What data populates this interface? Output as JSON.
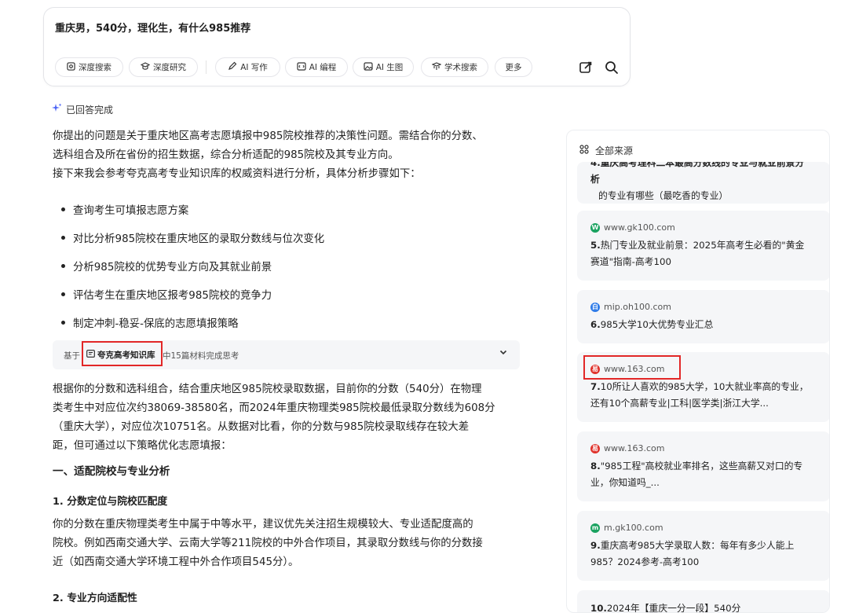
{
  "search": {
    "query": "重庆男，540分，理化生，有什么985推荐",
    "tools": [
      {
        "label": "深度搜索",
        "icon": "deep-search-icon"
      },
      {
        "label": "深度研究",
        "icon": "deep-research-icon"
      },
      {
        "label": "AI 写作",
        "icon": "pen-icon"
      },
      {
        "label": "AI 编程",
        "icon": "code-icon"
      },
      {
        "label": "AI 生图",
        "icon": "image-icon"
      },
      {
        "label": "学术搜索",
        "icon": "academic-icon"
      },
      {
        "label": "更多",
        "icon": ""
      }
    ]
  },
  "answer": {
    "status": "已回答完成",
    "intro": [
      "你提出的问题是关于重庆地区高考志愿填报中985院校推荐的决策性问题。需结合你的分数、",
      "选科组合及所在省份的招生数据，综合分析适配的985院校及其专业方向。",
      "接下来我会参考夸克高考专业知识库的权威资料进行分析，具体分析步骤如下："
    ],
    "steps": [
      "查询考生可填报志愿方案",
      "对比分析985院校在重庆地区的录取分数线与位次变化",
      "分析985院校的优势专业方向及其就业前景",
      "评估考生在重庆地区报考985院校的竞争力",
      "制定冲刺-稳妥-保底的志愿填报策略"
    ],
    "reference": {
      "prefix": "基于",
      "kb_name": "夸克高考知识库",
      "suffix": "中15篇材料完成思考"
    },
    "body1": [
      "根据你的分数和选科组合，结合重庆地区985院校录取数据，目前你的分数（540分）在物理",
      "类考生中对应位次约38069-38580名，而2024年重庆物理类985院校最低录取分数线为608分",
      "（重庆大学），对应位次10751名。从数据对比看，你的分数与985院校录取线存在较大差",
      "距，但可通过以下策略优化志愿填报："
    ],
    "heading1": "一、适配院校与专业分析",
    "heading1_1": "1. 分数定位与院校匹配度",
    "body2": [
      "你的分数在重庆物理类考生中属于中等水平，建议优先关注招生规模较大、专业适配度高的",
      "院校。例如西南交通大学、云南大学等211院校的中外合作项目，其录取分数线与你的分数接",
      "近（如西南交通大学环境工程中外合作项目545分）。"
    ],
    "heading1_2": "2. 专业方向适配性"
  },
  "sources": {
    "header": "全部来源",
    "items": [
      {
        "domain": "",
        "num": "",
        "title": "的专业有哪些（最吃香的专业）",
        "partial_top": "4.重庆高考理科二本最高分数线的专业与就业前景分析"
      },
      {
        "domain": "www.gk100.com",
        "num": "5.",
        "title": "热门专业及就业前景：2025年高考生必看的\"黄金赛道\"指南-高考100",
        "favicon": "gk",
        "color": "#1aa260"
      },
      {
        "domain": "mip.oh100.com",
        "num": "6.",
        "title": "985大学10大优势专业汇总",
        "favicon": "oh",
        "color": "#2f7ce8"
      },
      {
        "domain": "www.163.com",
        "num": "7.",
        "title": "10所让人喜欢的985大学，10大就业率高的专业，还有10个高薪专业|工科|医学类|浙江大学...",
        "favicon": "163",
        "color": "#e0312a"
      },
      {
        "domain": "www.163.com",
        "num": "8.",
        "title": "\"985工程\"高校就业率排名，这些高薪又对口的专业，你知道吗_...",
        "favicon": "163",
        "color": "#e0312a"
      },
      {
        "domain": "m.gk100.com",
        "num": "9.",
        "title": "重庆高考985大学录取人数：每年有多少人能上985？2024参考-高考100",
        "favicon": "gk",
        "color": "#1aa260"
      },
      {
        "domain": "",
        "num": "10.",
        "title": "2024年【重庆一分一段】540分"
      }
    ]
  }
}
